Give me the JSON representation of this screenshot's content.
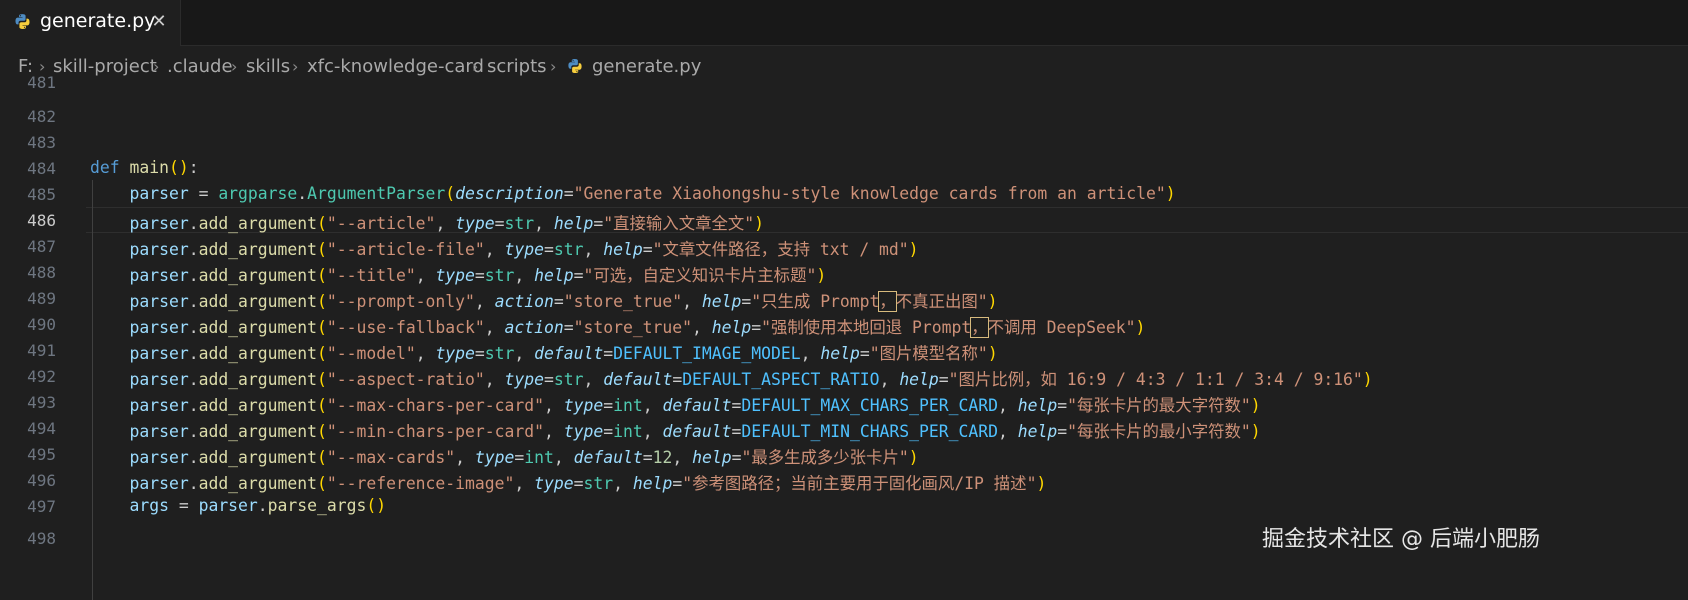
{
  "tab": {
    "filename": "generate.py",
    "close_glyph": "✕"
  },
  "breadcrumb": {
    "items": [
      "F:",
      "skill-project",
      ".claude",
      "skills",
      "xfc-knowledge-card",
      "scripts",
      "generate.py"
    ],
    "separator": "›"
  },
  "editor": {
    "active_line": "486",
    "line_numbers": [
      "481",
      "482",
      "483",
      "484",
      "485",
      "486",
      "487",
      "488",
      "489",
      "490",
      "491",
      "492",
      "493",
      "494",
      "495",
      "496",
      "497",
      "498"
    ],
    "lines": {
      "l484": {
        "def": "def",
        "name": "main",
        "open": "(",
        "close": ")",
        "colon": ":"
      },
      "l485": {
        "var": "parser",
        "eq": " = ",
        "mod": "argparse",
        "dot": ".",
        "cls": "ArgumentParser",
        "open": "(",
        "kw": "description",
        "eqk": "=",
        "str": "\"Generate Xiaohongshu-style knowledge cards from an article\"",
        "close": ")"
      },
      "l486": {
        "obj": "parser",
        "dot": ".",
        "fn": "add_argument",
        "open": "(",
        "flag": "\"--article\"",
        "c1": ", ",
        "k1": "type",
        "e1": "=",
        "v1": "str",
        "c2": ", ",
        "k2": "help",
        "e2": "=",
        "help": "\"直接输入文章全文\"",
        "close": ")"
      },
      "l487": {
        "obj": "parser",
        "dot": ".",
        "fn": "add_argument",
        "open": "(",
        "flag": "\"--article-file\"",
        "c1": ", ",
        "k1": "type",
        "e1": "=",
        "v1": "str",
        "c2": ", ",
        "k2": "help",
        "e2": "=",
        "help": "\"文章文件路径，支持 txt / md\"",
        "close": ")"
      },
      "l488": {
        "obj": "parser",
        "dot": ".",
        "fn": "add_argument",
        "open": "(",
        "flag": "\"--title\"",
        "c1": ", ",
        "k1": "type",
        "e1": "=",
        "v1": "str",
        "c2": ", ",
        "k2": "help",
        "e2": "=",
        "help": "\"可选，自定义知识卡片主标题\"",
        "close": ")"
      },
      "l489": {
        "obj": "parser",
        "dot": ".",
        "fn": "add_argument",
        "open": "(",
        "flag": "\"--prompt-only\"",
        "c1": ", ",
        "k1": "action",
        "e1": "=",
        "v1": "\"store_true\"",
        "c2": ", ",
        "k2": "help",
        "e2": "=",
        "help_a": "\"只生成 Prompt",
        "help_hl": "，",
        "help_b": "不真正出图\"",
        "close": ")"
      },
      "l490": {
        "obj": "parser",
        "dot": ".",
        "fn": "add_argument",
        "open": "(",
        "flag": "\"--use-fallback\"",
        "c1": ", ",
        "k1": "action",
        "e1": "=",
        "v1": "\"store_true\"",
        "c2": ", ",
        "k2": "help",
        "e2": "=",
        "help_a": "\"强制使用本地回退 Prompt",
        "help_hl": "，",
        "help_b": "不调用 DeepSeek\"",
        "close": ")"
      },
      "l491": {
        "obj": "parser",
        "dot": ".",
        "fn": "add_argument",
        "open": "(",
        "flag": "\"--model\"",
        "c1": ", ",
        "k1": "type",
        "e1": "=",
        "v1": "str",
        "c2": ", ",
        "k2": "default",
        "e2": "=",
        "v2": "DEFAULT_IMAGE_MODEL",
        "c3": ", ",
        "k3": "help",
        "e3": "=",
        "help": "\"图片模型名称\"",
        "close": ")"
      },
      "l492": {
        "obj": "parser",
        "dot": ".",
        "fn": "add_argument",
        "open": "(",
        "flag": "\"--aspect-ratio\"",
        "c1": ", ",
        "k1": "type",
        "e1": "=",
        "v1": "str",
        "c2": ", ",
        "k2": "default",
        "e2": "=",
        "v2": "DEFAULT_ASPECT_RATIO",
        "c3": ", ",
        "k3": "help",
        "e3": "=",
        "help": "\"图片比例，如 16:9 / 4:3 / 1:1 / 3:4 / 9:16\"",
        "close": ")"
      },
      "l493": {
        "obj": "parser",
        "dot": ".",
        "fn": "add_argument",
        "open": "(",
        "flag": "\"--max-chars-per-card\"",
        "c1": ", ",
        "k1": "type",
        "e1": "=",
        "v1": "int",
        "c2": ", ",
        "k2": "default",
        "e2": "=",
        "v2": "DEFAULT_MAX_CHARS_PER_CARD",
        "c3": ", ",
        "k3": "help",
        "e3": "=",
        "help": "\"每张卡片的最大字符数\"",
        "close": ")"
      },
      "l494": {
        "obj": "parser",
        "dot": ".",
        "fn": "add_argument",
        "open": "(",
        "flag": "\"--min-chars-per-card\"",
        "c1": ", ",
        "k1": "type",
        "e1": "=",
        "v1": "int",
        "c2": ", ",
        "k2": "default",
        "e2": "=",
        "v2": "DEFAULT_MIN_CHARS_PER_CARD",
        "c3": ", ",
        "k3": "help",
        "e3": "=",
        "help": "\"每张卡片的最小字符数\"",
        "close": ")"
      },
      "l495": {
        "obj": "parser",
        "dot": ".",
        "fn": "add_argument",
        "open": "(",
        "flag": "\"--max-cards\"",
        "c1": ", ",
        "k1": "type",
        "e1": "=",
        "v1": "int",
        "c2": ", ",
        "k2": "default",
        "e2": "=",
        "v2": "12",
        "c3": ", ",
        "k3": "help",
        "e3": "=",
        "help": "\"最多生成多少张卡片\"",
        "close": ")"
      },
      "l496": {
        "obj": "parser",
        "dot": ".",
        "fn": "add_argument",
        "open": "(",
        "flag": "\"--reference-image\"",
        "c1": ", ",
        "k1": "type",
        "e1": "=",
        "v1": "str",
        "c2": ", ",
        "k2": "help",
        "e2": "=",
        "help": "\"参考图路径；当前主要用于固化画风/IP 描述\"",
        "close": ")"
      },
      "l497": {
        "var": "args",
        "eq": " = ",
        "obj": "parser",
        "dot": ".",
        "fn": "parse_args",
        "open": "(",
        "close": ")"
      }
    }
  },
  "watermark": "掘金技术社区 @ 后端小肥肠",
  "colors": {
    "background": "#1f1f1f",
    "tabbar": "#181818",
    "keyword": "#569cd6",
    "function": "#dcdcaa",
    "class": "#4ec9b0",
    "string": "#ce9178",
    "variable": "#9cdcfe",
    "bracket1": "#ffd700",
    "bracket2": "#da70d6"
  },
  "icons": {
    "file": "python-file-icon",
    "close": "close-icon",
    "separator": "chevron-right-icon"
  }
}
